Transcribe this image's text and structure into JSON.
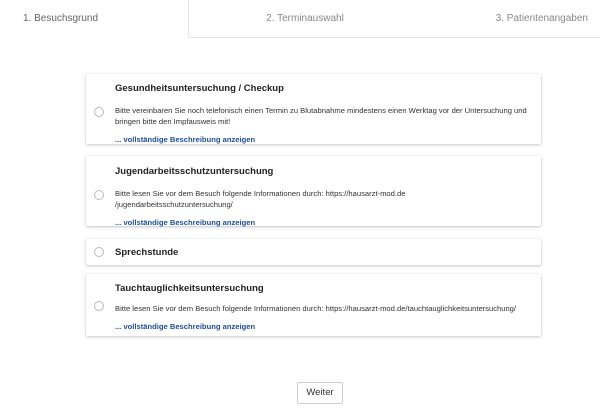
{
  "tabs": [
    {
      "label": "1. Besuchsgrund",
      "active": true
    },
    {
      "label": "2. Terminauswahl",
      "active": false
    },
    {
      "label": "3. Patientenangaben",
      "active": false
    }
  ],
  "reasons": [
    {
      "title": "Gesundheitsuntersuchung / Checkup",
      "description": "Bitte vereinbaren Sie noch telefonisch einen Termin zu Blutabnahme mindestens einen Werktag vor der Untersuchung und bringen bitte den Impfausweis mit!",
      "more": "... vollständige Beschreibung anzeigen"
    },
    {
      "title": "Jugendarbeitsschutzuntersuchung",
      "description_line1": "Bitte lesen Sie vor dem Besuch folgende Informationen durch: https://hausarzt-mod.de",
      "description_line2": "/jugendarbeitsschutzuntersuchung/",
      "more": "... vollständige Beschreibung anzeigen"
    },
    {
      "title": "Sprechstunde"
    },
    {
      "title": "Tauchtauglichkeitsuntersuchung",
      "description": "Bitte lesen Sie vor dem Besuch folgende Informationen durch: https://hausarzt-mod.de/tauchtauglichkeitsuntersuchung/",
      "more": "... vollständige Beschreibung anzeigen"
    }
  ],
  "next_button": "Weiter",
  "colors": {
    "link": "#1e4fa0",
    "border": "#e3e3e3"
  }
}
